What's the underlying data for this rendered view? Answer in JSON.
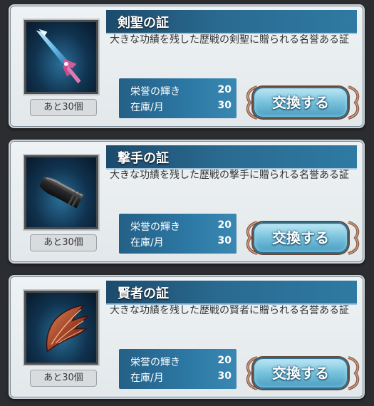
{
  "items": [
    {
      "name": "剣聖の証",
      "description": "大きな功績を残した歴戦の剣聖に贈られる名誉ある証",
      "icon": "crystal-sword-icon",
      "remaining": "あと30個",
      "cost_label": "栄誉の輝き",
      "cost_value": "20",
      "stock_label": "在庫/月",
      "stock_value": "30",
      "button_label": "交換する"
    },
    {
      "name": "撃手の証",
      "description": "大きな功績を残した歴戦の撃手に贈られる名誉ある証",
      "icon": "bullet-icon",
      "remaining": "あと30個",
      "cost_label": "栄誉の輝き",
      "cost_value": "20",
      "stock_label": "在庫/月",
      "stock_value": "30",
      "button_label": "交換する"
    },
    {
      "name": "賢者の証",
      "description": "大きな功績を残した歴戦の賢者に贈られる名誉ある証",
      "icon": "wing-icon",
      "remaining": "あと30個",
      "cost_label": "栄誉の輝き",
      "cost_value": "20",
      "stock_label": "在庫/月",
      "stock_value": "30",
      "button_label": "交換する"
    }
  ],
  "colors": {
    "title_bar": "#2a6a90",
    "stats_bg": "#2d79a5",
    "button": "#7cc5df",
    "card_bg": "#eef2f4"
  }
}
